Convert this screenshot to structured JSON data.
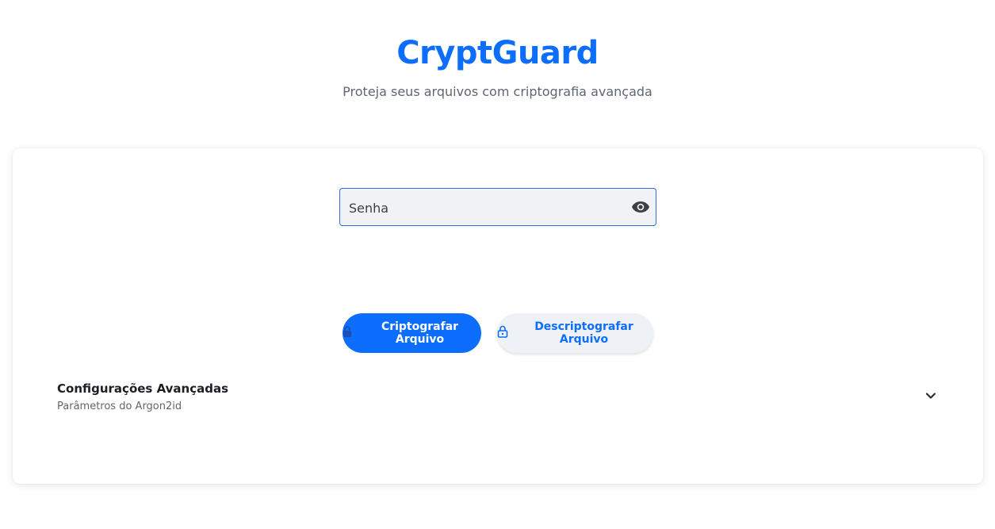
{
  "header": {
    "title": "CryptGuard",
    "subtitle": "Proteja seus arquivos com criptografia avançada"
  },
  "password": {
    "placeholder": "Senha",
    "value": "",
    "toggle_icon": "eye-icon"
  },
  "actions": {
    "encrypt_label": "Criptografar Arquivo",
    "encrypt_icon": "lock-icon",
    "decrypt_label": "Descriptografar Arquivo",
    "decrypt_icon": "lock-open-icon"
  },
  "advanced": {
    "title": "Configurações Avançadas",
    "subtitle": "Parâmetros do Argon2id",
    "expand_icon": "chevron-down-icon"
  },
  "colors": {
    "accent": "#0d6efd",
    "field_bg": "#f0f2f5",
    "secondary_button_bg": "#eef1f6"
  }
}
